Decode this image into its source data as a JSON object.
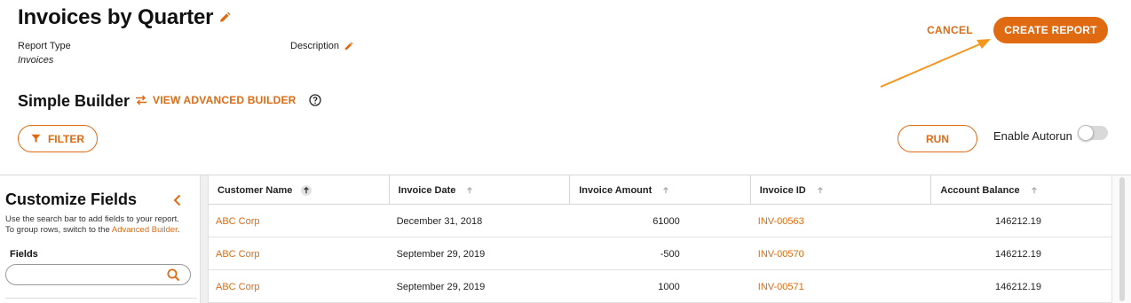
{
  "page": {
    "title": "Invoices by Quarter",
    "report_type_label": "Report Type",
    "report_type_value": "Invoices",
    "description_label": "Description"
  },
  "actions": {
    "cancel_label": "CANCEL",
    "create_label": "CREATE REPORT"
  },
  "builder": {
    "title": "Simple Builder",
    "advanced_link": "VIEW ADVANCED BUILDER",
    "filter_label": "FILTER",
    "run_label": "RUN",
    "autorun_label": "Enable Autorun",
    "autorun_enabled": false
  },
  "sidebar": {
    "title": "Customize Fields",
    "help_text_1": "Use the search bar to add fields to your report.",
    "help_text_2": "To group rows, switch to the ",
    "help_link": "Advanced Builder",
    "help_text_3": ".",
    "fields_label": "Fields",
    "search_value": "",
    "search_placeholder": ""
  },
  "table": {
    "columns": [
      "Customer Name",
      "Invoice Date",
      "Invoice Amount",
      "Invoice ID",
      "Account Balance"
    ],
    "rows": [
      {
        "customer": "ABC Corp",
        "date": "December 31, 2018",
        "amount": "61000",
        "invoice_id": "INV-00563",
        "balance": "146212.19"
      },
      {
        "customer": "ABC Corp",
        "date": "September 29, 2019",
        "amount": "-500",
        "invoice_id": "INV-00570",
        "balance": "146212.19"
      },
      {
        "customer": "ABC Corp",
        "date": "September 29, 2019",
        "amount": "1000",
        "invoice_id": "INV-00571",
        "balance": "146212.19"
      }
    ]
  },
  "colors": {
    "accent": "#e06a12",
    "annotation_arrow": "#f5961f",
    "toggle_off": "#d9d9d9"
  },
  "icons": {
    "title_edit": "pencil-icon",
    "description_edit": "pencil-icon",
    "advanced_link": "swap-arrows-icon",
    "help": "question-circle-icon",
    "filter": "funnel-icon",
    "collapse": "chevron-left-icon",
    "search": "magnifier-icon",
    "sort": "sort-up-arrow-icon"
  }
}
